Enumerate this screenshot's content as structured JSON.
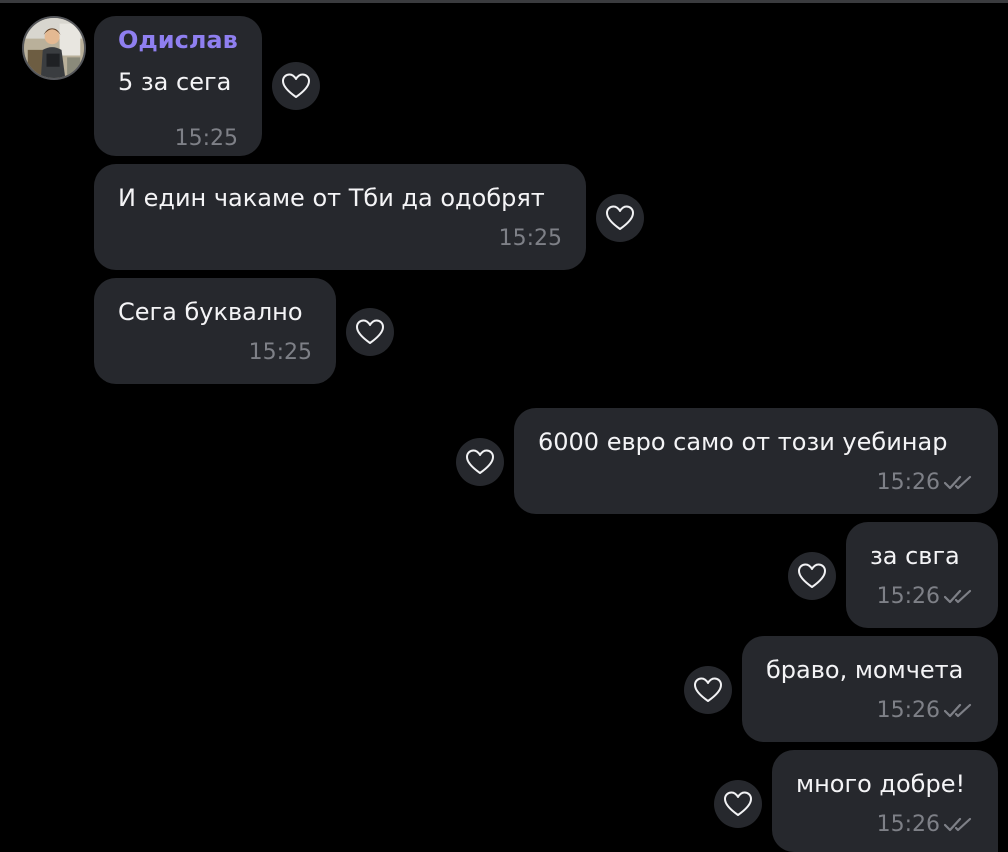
{
  "chat": {
    "sender_name": "Одислав",
    "avatar_icon": "user-avatar-icon",
    "react_icon": "heart-outline-icon",
    "read_icon": "double-check-icon",
    "colors": {
      "background": "#000000",
      "bubble": "#26282d",
      "sender_name": "#8f7ff0",
      "time": "#7e8087"
    },
    "messages": [
      {
        "direction": "incoming",
        "text": "5 за сега",
        "time": "15:25"
      },
      {
        "direction": "incoming",
        "text": "И един чакаме от Тби да одобрят",
        "time": "15:25"
      },
      {
        "direction": "incoming",
        "text": "Сега буквално",
        "time": "15:25"
      },
      {
        "direction": "outgoing",
        "text": "6000 евро само от този уебинар",
        "time": "15:26",
        "status": "read"
      },
      {
        "direction": "outgoing",
        "text": "за свга",
        "time": "15:26",
        "status": "read"
      },
      {
        "direction": "outgoing",
        "text": "браво, момчета",
        "time": "15:26",
        "status": "read"
      },
      {
        "direction": "outgoing",
        "text": "много добре!",
        "time": "15:26",
        "status": "read"
      }
    ]
  }
}
